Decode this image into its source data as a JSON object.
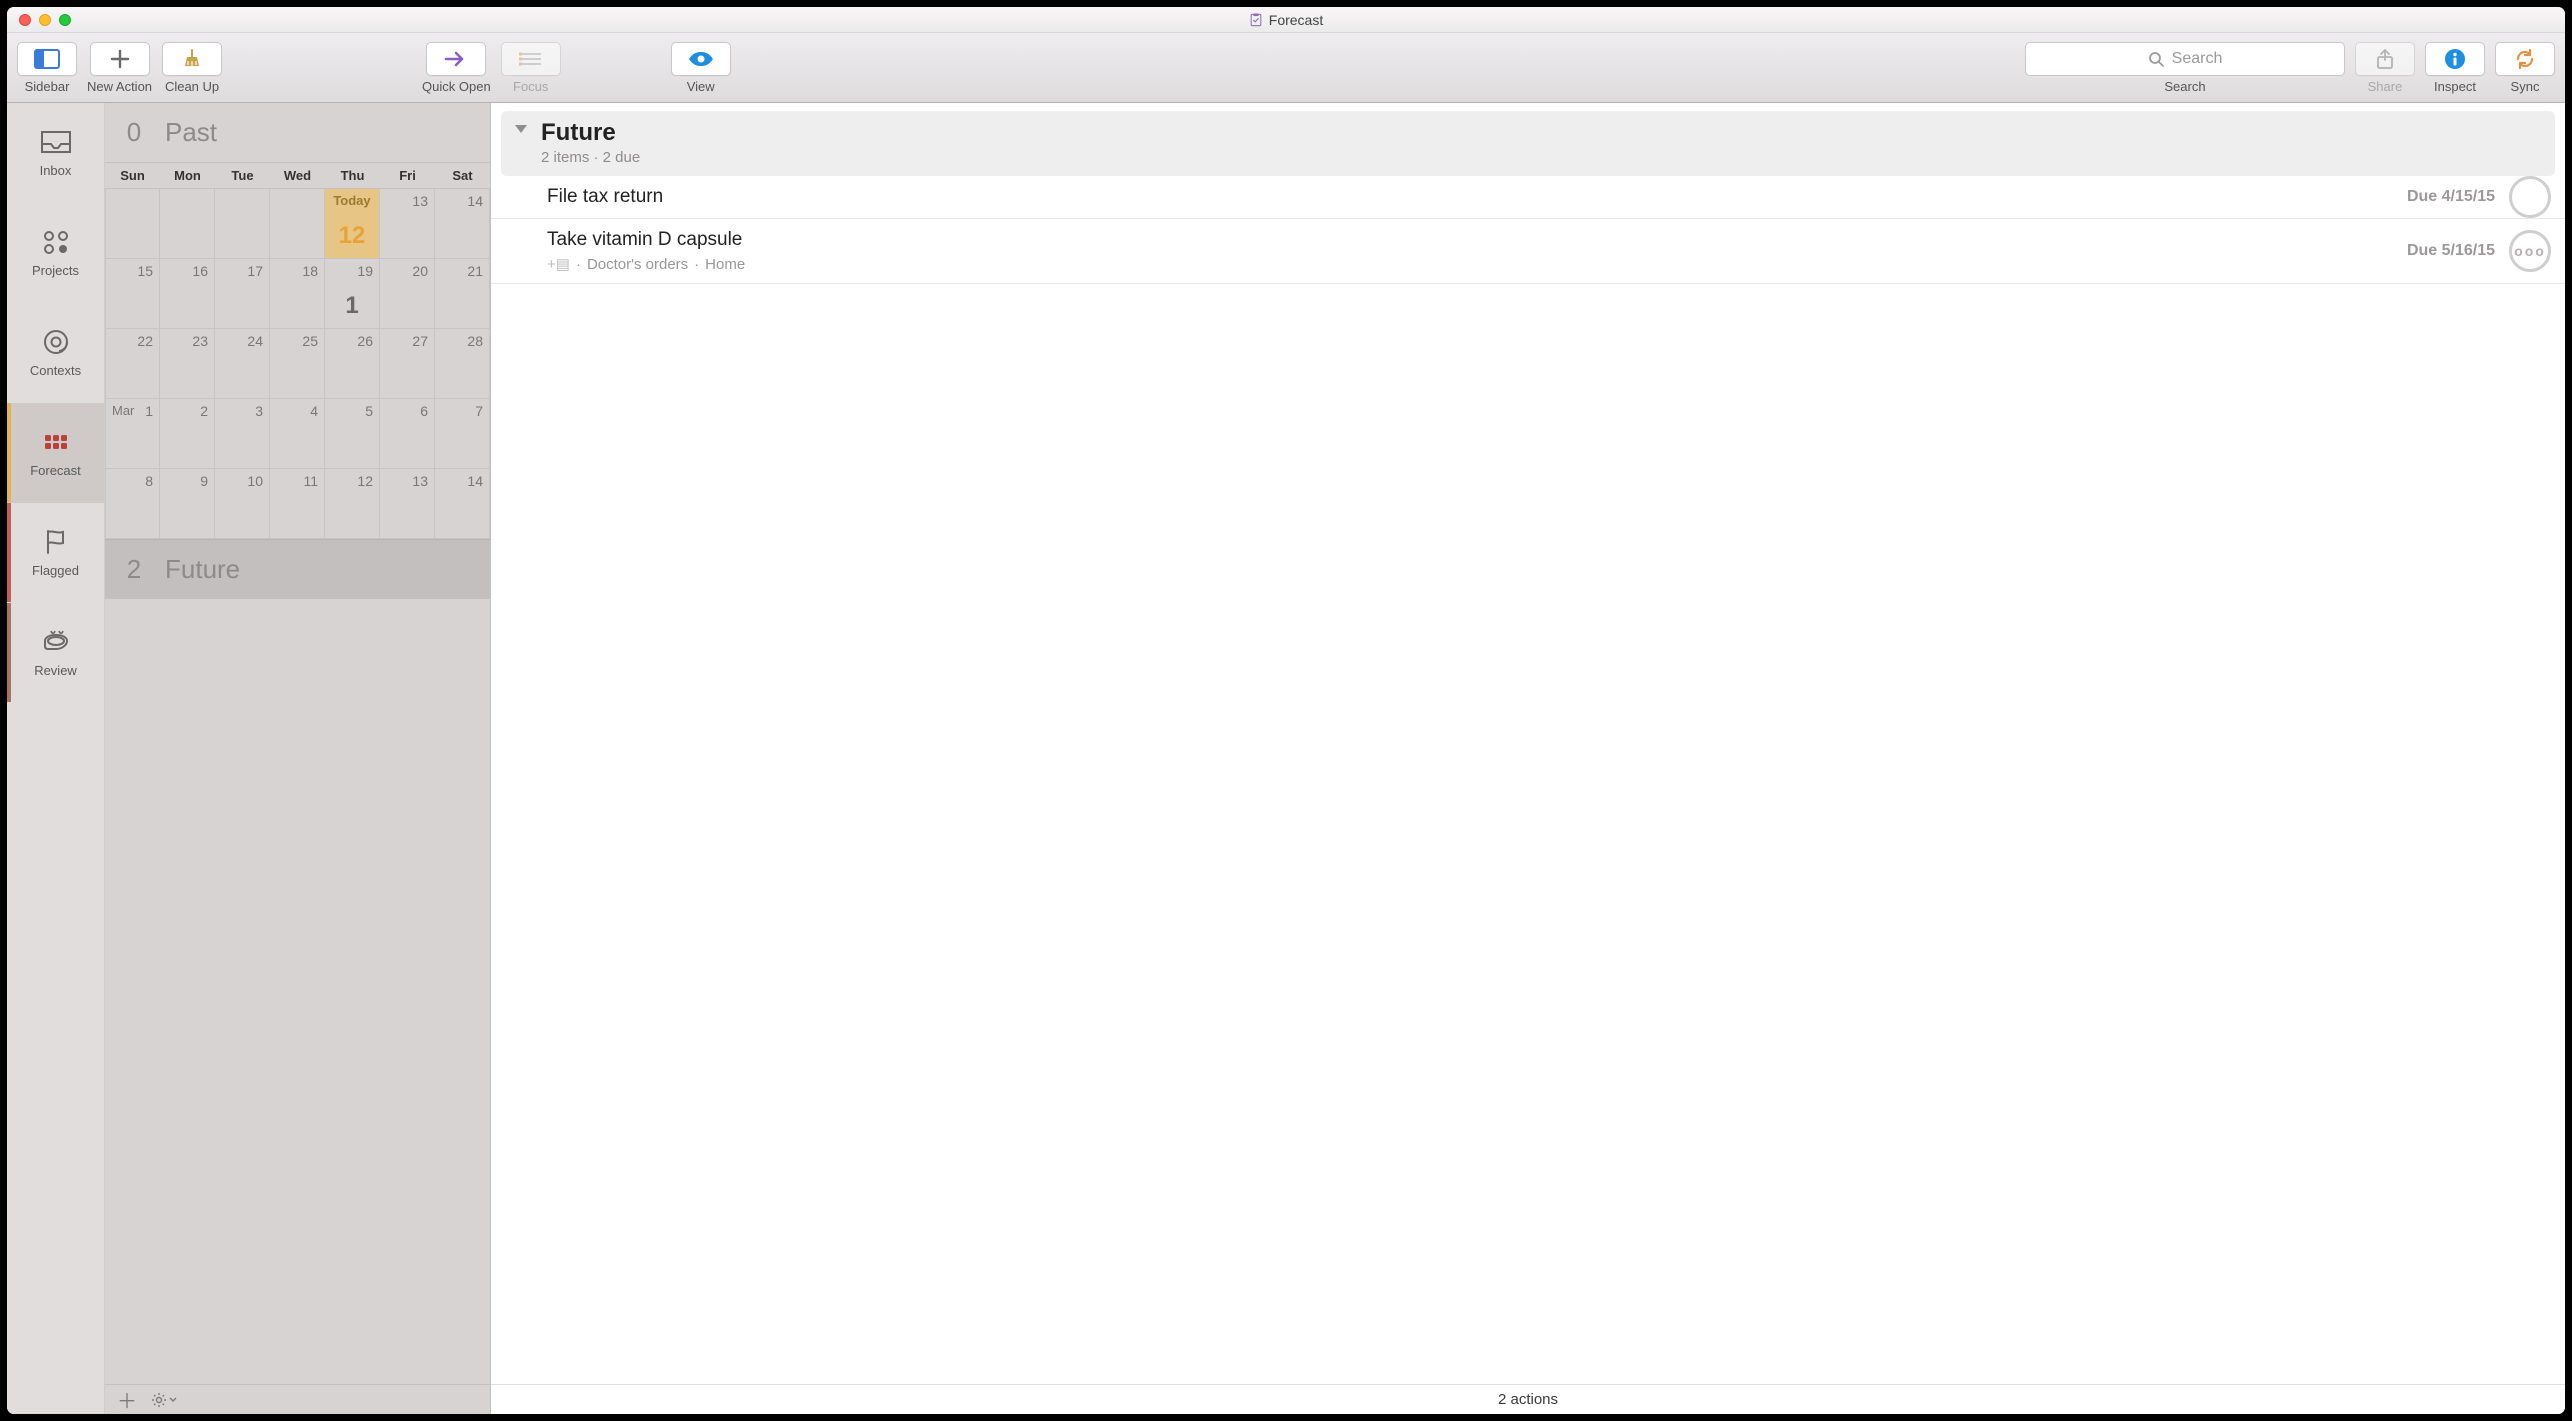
{
  "window": {
    "title": "Forecast"
  },
  "toolbar": {
    "sidebar": "Sidebar",
    "new_action": "New Action",
    "clean_up": "Clean Up",
    "quick_open": "Quick Open",
    "focus": "Focus",
    "view": "View",
    "search_label": "Search",
    "search_placeholder": "Search",
    "share": "Share",
    "inspect": "Inspect",
    "sync": "Sync"
  },
  "perspectives": [
    {
      "id": "inbox",
      "label": "Inbox"
    },
    {
      "id": "projects",
      "label": "Projects"
    },
    {
      "id": "contexts",
      "label": "Contexts"
    },
    {
      "id": "forecast",
      "label": "Forecast",
      "selected": true,
      "marker": "yellow"
    },
    {
      "id": "flagged",
      "label": "Flagged",
      "marker": "red"
    },
    {
      "id": "review",
      "label": "Review",
      "marker": "brown"
    }
  ],
  "forecast": {
    "past": {
      "count": "0",
      "label": "Past"
    },
    "future": {
      "count": "2",
      "label": "Future"
    },
    "weekdays": [
      "Sun",
      "Mon",
      "Tue",
      "Wed",
      "Thu",
      "Fri",
      "Sat"
    ],
    "rows": [
      [
        {
          "d": ""
        },
        {
          "d": ""
        },
        {
          "d": ""
        },
        {
          "d": ""
        },
        {
          "d": "12",
          "today": true,
          "today_label": "Today",
          "count": "12"
        },
        {
          "d": "13"
        },
        {
          "d": "14"
        }
      ],
      [
        {
          "d": "15"
        },
        {
          "d": "16"
        },
        {
          "d": "17"
        },
        {
          "d": "18"
        },
        {
          "d": "19",
          "count": "1"
        },
        {
          "d": "20"
        },
        {
          "d": "21"
        }
      ],
      [
        {
          "d": "22"
        },
        {
          "d": "23"
        },
        {
          "d": "24"
        },
        {
          "d": "25"
        },
        {
          "d": "26"
        },
        {
          "d": "27"
        },
        {
          "d": "28"
        }
      ],
      [
        {
          "d": "1",
          "month": "Mar"
        },
        {
          "d": "2"
        },
        {
          "d": "3"
        },
        {
          "d": "4"
        },
        {
          "d": "5"
        },
        {
          "d": "6"
        },
        {
          "d": "7"
        }
      ],
      [
        {
          "d": "8"
        },
        {
          "d": "9"
        },
        {
          "d": "10"
        },
        {
          "d": "11"
        },
        {
          "d": "12"
        },
        {
          "d": "13"
        },
        {
          "d": "14"
        }
      ]
    ]
  },
  "tasklist": {
    "header": {
      "title": "Future",
      "subtitle": "2 items · 2 due"
    },
    "tasks": [
      {
        "title": "File tax return",
        "due": "Due 4/15/15",
        "status_icon": "circle"
      },
      {
        "title": "Take vitamin D capsule",
        "due": "Due 5/16/15",
        "project": "Doctor's orders",
        "context": "Home",
        "status_icon": "repeat"
      }
    ],
    "footer": "2 actions"
  },
  "row1_count": "1"
}
